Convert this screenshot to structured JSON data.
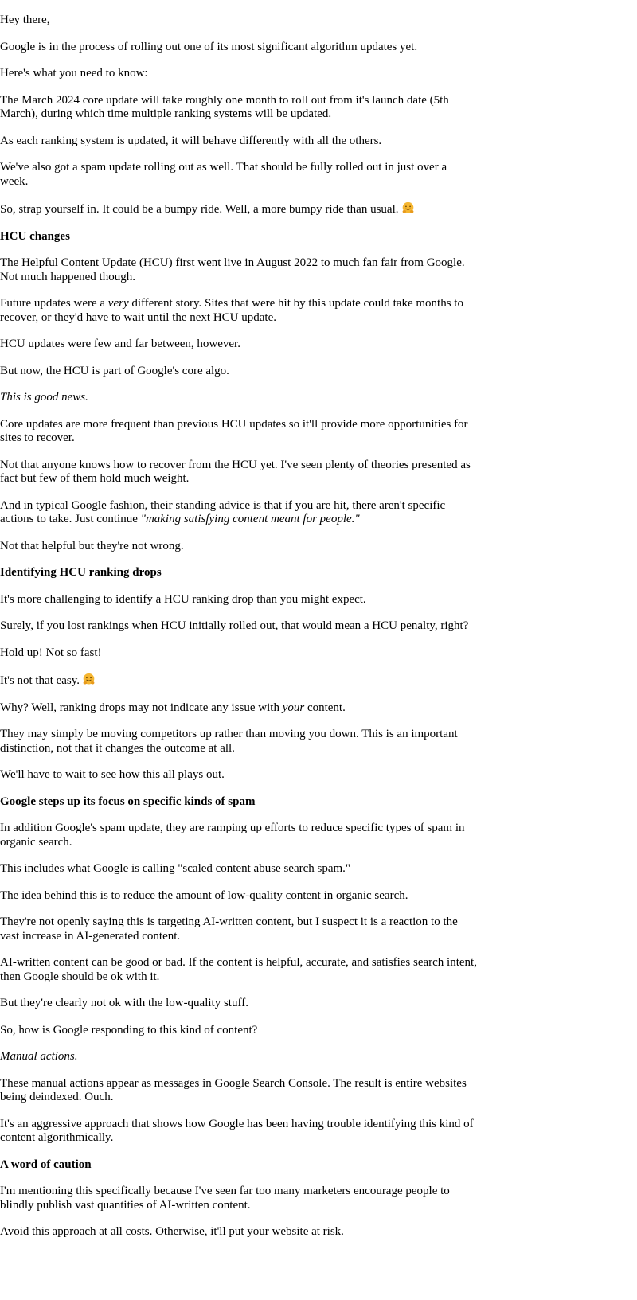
{
  "email": {
    "greeting": "Hey there,",
    "intro": [
      "Google is in the process of rolling out one of its most significant algorithm updates yet.",
      "Here's what you need to know:",
      "The March 2024 core update will take roughly one month to roll out from it's launch date (5th March), during which time multiple ranking systems will be updated.",
      "As each ranking system is updated, it will behave differently with all the others.",
      "We've also got a spam update rolling out as well. That should be fully rolled out in just over a week.",
      "So, strap yourself in. It could be a bumpy ride. Well, a more bumpy ride than usual."
    ],
    "hcu": {
      "heading": "HCU changes",
      "p1": "The Helpful Content Update (HCU) first went live in August 2022 to much fan fair from Google. Not much happened though.",
      "p2_before": "Future updates were a ",
      "p2_em": "very",
      "p2_after": " different story. Sites that were hit by this update could take months to recover, or they'd have to wait until the next HCU update.",
      "p3": "HCU updates were few and far between, however.",
      "p4": "But now, the HCU is part of Google's core algo.",
      "p5": "This is good news.",
      "p6": "Core updates are more frequent than previous HCU updates so it'll provide more opportunities for sites to recover.",
      "p7": "Not that anyone knows how to recover from the HCU yet. I've seen plenty of theories presented as fact but few of them hold much weight.",
      "p8_before": "And in typical Google fashion, their standing advice is that if you are hit, there aren't specific actions to take. Just continue ",
      "p8_em": "\"making satisfying content meant for people.\"",
      "p9": "Not that helpful but they're not wrong."
    },
    "identifying": {
      "heading": "Identifying HCU ranking drops",
      "p1": "It's more challenging to identify a HCU ranking drop than you might expect.",
      "p2": "Surely, if you lost rankings when HCU initially rolled out, that would mean a HCU penalty, right?",
      "p3": "Hold up! Not so fast!",
      "p4": "It's not that easy.",
      "p5_before": "Why? Well, ranking drops may not indicate any issue with ",
      "p5_em": "your",
      "p5_after": " content.",
      "p6": "They may simply be moving competitors up rather than moving you down. This is an important distinction, not that it changes the outcome at all.",
      "p7": "We'll have to wait to see how this all plays out."
    },
    "spam": {
      "heading": "Google steps up its focus on specific kinds of spam",
      "p1": "In addition Google's spam update, they are ramping up efforts to reduce specific types of spam in organic search.",
      "p2": "This includes what Google is calling \"scaled content abuse search spam.\"",
      "p3": "The idea behind this is to reduce the amount of low-quality content in organic search.",
      "p4": "They're not openly saying this is targeting AI-written content, but I suspect it is a reaction to the vast increase in AI-generated content.",
      "p5": "AI-written content can be good or bad. If the content is helpful, accurate, and satisfies search intent, then Google should be ok with it.",
      "p6": "But they're clearly not ok with the low-quality stuff.",
      "p7": "So, how is Google responding to this kind of content?",
      "p8": "Manual actions.",
      "p9": "These manual actions appear as messages in Google Search Console. The result is entire websites being deindexed. Ouch.",
      "p10": "It's an aggressive approach that shows how Google has been having trouble identifying this kind of content algorithmically."
    },
    "caution": {
      "heading": "A word of caution",
      "p1": "I'm mentioning this specifically because I've seen far too many marketers encourage people to blindly publish vast quantities of AI-written content.",
      "p2": "Avoid this approach at all costs. Otherwise, it'll put your website at risk."
    },
    "icons": {
      "emoji": "hugging-face-emoji-icon",
      "emoji_color": "#f5b631"
    }
  }
}
